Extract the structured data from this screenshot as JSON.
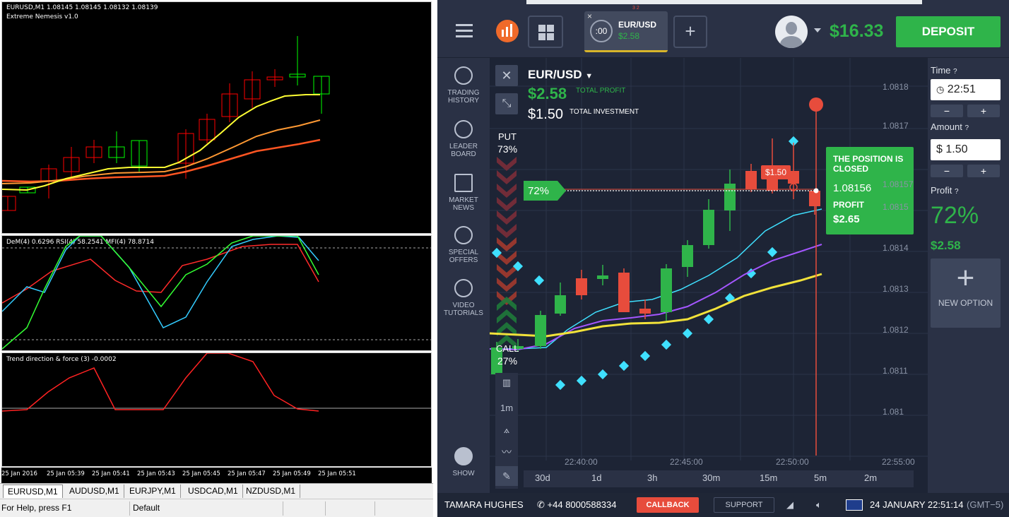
{
  "mt4": {
    "chart_title": "EURUSD,M1  1.08145 1.08145 1.08132 1.08139",
    "indicator_name": "Extreme Nemesis v1.0",
    "osc_label": "DeM(4) 0.6296  RSI(4) 58.2541  MFI(4) 78.8714",
    "trend_label": "Trend direction & force (3) -0.0002",
    "time_labels": [
      "25 Jan 2016",
      "25 Jan 05:39",
      "25 Jan 05:41",
      "25 Jan 05:43",
      "25 Jan 05:45",
      "25 Jan 05:47",
      "25 Jan 05:49",
      "25 Jan 05:51"
    ],
    "tabs": [
      "EURUSD,M1",
      "AUDUSD,M1",
      "EURJPY,M1",
      "USDCAD,M1",
      "NZDUSD,M1"
    ],
    "status_help": "For Help, press F1",
    "status_profile": "Default",
    "colors": {
      "bull": "#00ff00",
      "bear": "#ff0000",
      "ma_fast": "#ffff33",
      "ma_mid": "#ff9933",
      "ma_slow": "#ff5522",
      "cyan": "#33ccff"
    }
  },
  "iq": {
    "asset_tab": {
      "timer": ":00",
      "name": "EUR/USD",
      "profit": "$2.58",
      "badge": "3 2"
    },
    "add_tab": "+",
    "balance": "$16.33",
    "deposit_label": "DEPOSIT",
    "sidebar": [
      {
        "label": "TRADING HISTORY",
        "icon": "history-icon"
      },
      {
        "label": "LEADER BOARD",
        "icon": "leaderboard-icon"
      },
      {
        "label": "MARKET NEWS",
        "icon": "news-icon"
      },
      {
        "label": "SPECIAL OFFERS",
        "icon": "offers-icon"
      },
      {
        "label": "VIDEO TUTORIALS",
        "icon": "video-icon"
      }
    ],
    "show_label": "SHOW",
    "asset_name": "EUR/USD",
    "total_profit_value": "$2.58",
    "total_profit_label": "TOTAL PROFIT",
    "total_investment_value": "$1.50",
    "total_investment_label": "TOTAL INVESTMENT",
    "put_label": "PUT",
    "put_pct": "73%",
    "call_label": "CALL",
    "call_pct": "27%",
    "payout_marker": "72%",
    "trade_marker": "$1.50",
    "timeframe_button": "1m",
    "popup": {
      "title": "THE POSITION IS CLOSED",
      "price": "1.08156",
      "profit_label": "PROFIT",
      "profit_value": "$2.65"
    },
    "price_levels": [
      "1.0818",
      "1.0817",
      "1.08157",
      "1.0815",
      "1.0814",
      "1.0813",
      "1.0812",
      "1.0811",
      "1.081"
    ],
    "time_labels": [
      "22:40:00",
      "22:45:00",
      "22:50:00",
      "22:55:00"
    ],
    "timeframes": [
      "30d",
      "1d",
      "3h",
      "30m",
      "15m",
      "5m",
      "2m"
    ],
    "time_label": "Time",
    "time_value": "22:51",
    "amount_label": "Amount",
    "amount_value": "$ 1.50",
    "minus": "−",
    "plus": "+",
    "profit_label": "Profit",
    "profit_pct": "72%",
    "profit_value": "$2.58",
    "new_option": "NEW OPTION",
    "bottom": {
      "user": "TAMARA HUGHES",
      "phone": "+44 8000588334",
      "callback": "CALLBACK",
      "support": "SUPPORT",
      "datetime": "24 JANUARY 22:51:14",
      "timezone": "(GMT−5)"
    },
    "colors": {
      "green": "#2fb44a",
      "red": "#e74c3c",
      "cyan": "#3fe0ff",
      "purple": "#a456ff",
      "yellow": "#f2e23a",
      "bg": "#1d2435"
    }
  }
}
